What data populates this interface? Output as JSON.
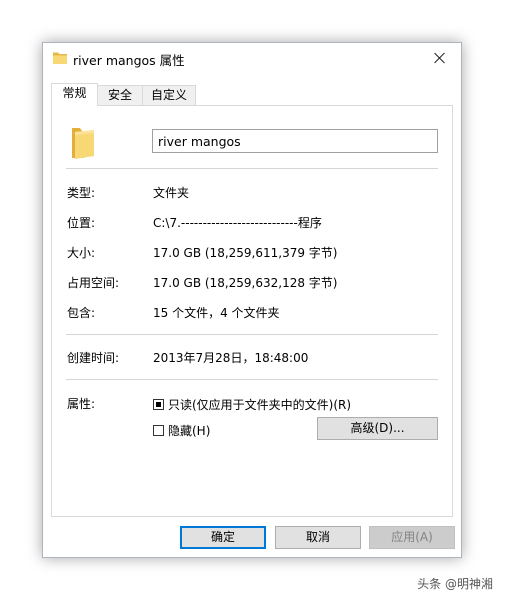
{
  "window": {
    "title": "river mangos 属性",
    "title_icon": "folder-icon",
    "close_icon": "close-icon"
  },
  "tabs": [
    {
      "label": "常规",
      "active": true
    },
    {
      "label": "安全",
      "active": false
    },
    {
      "label": "自定义",
      "active": false
    }
  ],
  "general": {
    "folder_icon": "folder-icon",
    "name_value": "river mangos",
    "rows": {
      "type_label": "类型:",
      "type_value": "文件夹",
      "location_label": "位置:",
      "location_value": "C:\\7.---------------------------程序",
      "size_label": "大小:",
      "size_value": "17.0 GB (18,259,611,379 字节)",
      "disk_label": "占用空间:",
      "disk_value": "17.0 GB (18,259,632,128 字节)",
      "contains_label": "包含:",
      "contains_value": "15 个文件，4 个文件夹",
      "created_label": "创建时间:",
      "created_value": "2013年7月28日，18:48:00",
      "attributes_label": "属性:"
    },
    "readonly_label": "只读(仅应用于文件夹中的文件)(R)",
    "readonly_state": "indeterminate",
    "hidden_label": "隐藏(H)",
    "hidden_checked": false,
    "advanced_label": "高级(D)..."
  },
  "buttons": {
    "ok": "确定",
    "cancel": "取消",
    "apply": "应用(A)"
  },
  "watermark": "头条 @明神湘",
  "colors": {
    "accent": "#0078d7",
    "folder_yellow": "#f8d775"
  }
}
